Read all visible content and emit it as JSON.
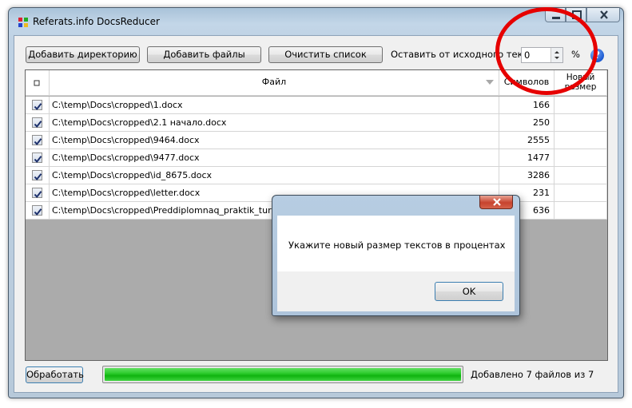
{
  "window": {
    "title": "Referats.info DocsReducer",
    "caption_buttons": [
      "minimize-icon",
      "maximize-icon",
      "close-icon"
    ]
  },
  "toolbar": {
    "add_directory": "Добавить директорию",
    "add_files": "Добавить файлы",
    "clear_list": "Очистить список",
    "keep_label": "Оставить от исходного текста",
    "keep_value": "0",
    "percent": "%",
    "help": "?"
  },
  "grid": {
    "columns": {
      "check": "",
      "file": "Файл",
      "chars": "Символов",
      "new_size": "Новый размер"
    },
    "rows": [
      {
        "checked": true,
        "file": "C:\\temp\\Docs\\cropped\\1.docx",
        "chars": "166",
        "new_size": ""
      },
      {
        "checked": true,
        "file": "C:\\temp\\Docs\\cropped\\2.1 начало.docx",
        "chars": "250",
        "new_size": ""
      },
      {
        "checked": true,
        "file": "C:\\temp\\Docs\\cropped\\9464.docx",
        "chars": "2555",
        "new_size": ""
      },
      {
        "checked": true,
        "file": "C:\\temp\\Docs\\cropped\\9477.docx",
        "chars": "1477",
        "new_size": ""
      },
      {
        "checked": true,
        "file": "C:\\temp\\Docs\\cropped\\id_8675.docx",
        "chars": "3286",
        "new_size": ""
      },
      {
        "checked": true,
        "file": "C:\\temp\\Docs\\cropped\\letter.docx",
        "chars": "231",
        "new_size": ""
      },
      {
        "checked": true,
        "file": "C:\\temp\\Docs\\cropped\\Preddiplomnaq_praktik_turizm.docx",
        "chars": "636",
        "new_size": ""
      }
    ]
  },
  "footer": {
    "process_button": "Обработать",
    "progress": 1.0,
    "status": "Добавлено 7 файлов из 7"
  },
  "dialog": {
    "message": "Укажите новый размер текстов в процентах",
    "ok": "OK"
  },
  "colors": {
    "annotation_ring": "#e60000",
    "progress": "#1ec21e"
  }
}
